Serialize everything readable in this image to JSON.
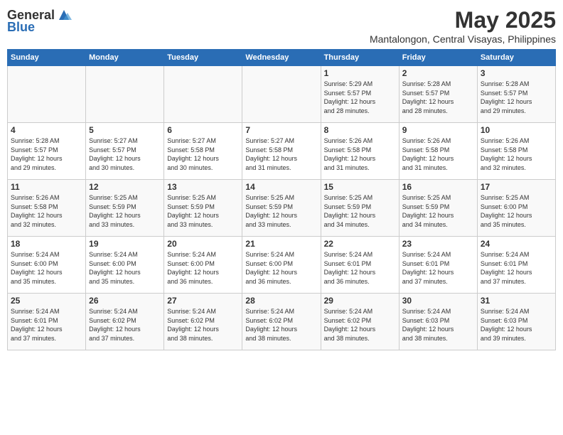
{
  "header": {
    "logo_general": "General",
    "logo_blue": "Blue",
    "month_title": "May 2025",
    "subtitle": "Mantalongon, Central Visayas, Philippines"
  },
  "weekdays": [
    "Sunday",
    "Monday",
    "Tuesday",
    "Wednesday",
    "Thursday",
    "Friday",
    "Saturday"
  ],
  "weeks": [
    [
      {
        "day": "",
        "text": ""
      },
      {
        "day": "",
        "text": ""
      },
      {
        "day": "",
        "text": ""
      },
      {
        "day": "",
        "text": ""
      },
      {
        "day": "1",
        "text": "Sunrise: 5:29 AM\nSunset: 5:57 PM\nDaylight: 12 hours\nand 28 minutes."
      },
      {
        "day": "2",
        "text": "Sunrise: 5:28 AM\nSunset: 5:57 PM\nDaylight: 12 hours\nand 28 minutes."
      },
      {
        "day": "3",
        "text": "Sunrise: 5:28 AM\nSunset: 5:57 PM\nDaylight: 12 hours\nand 29 minutes."
      }
    ],
    [
      {
        "day": "4",
        "text": "Sunrise: 5:28 AM\nSunset: 5:57 PM\nDaylight: 12 hours\nand 29 minutes."
      },
      {
        "day": "5",
        "text": "Sunrise: 5:27 AM\nSunset: 5:57 PM\nDaylight: 12 hours\nand 30 minutes."
      },
      {
        "day": "6",
        "text": "Sunrise: 5:27 AM\nSunset: 5:58 PM\nDaylight: 12 hours\nand 30 minutes."
      },
      {
        "day": "7",
        "text": "Sunrise: 5:27 AM\nSunset: 5:58 PM\nDaylight: 12 hours\nand 31 minutes."
      },
      {
        "day": "8",
        "text": "Sunrise: 5:26 AM\nSunset: 5:58 PM\nDaylight: 12 hours\nand 31 minutes."
      },
      {
        "day": "9",
        "text": "Sunrise: 5:26 AM\nSunset: 5:58 PM\nDaylight: 12 hours\nand 31 minutes."
      },
      {
        "day": "10",
        "text": "Sunrise: 5:26 AM\nSunset: 5:58 PM\nDaylight: 12 hours\nand 32 minutes."
      }
    ],
    [
      {
        "day": "11",
        "text": "Sunrise: 5:26 AM\nSunset: 5:58 PM\nDaylight: 12 hours\nand 32 minutes."
      },
      {
        "day": "12",
        "text": "Sunrise: 5:25 AM\nSunset: 5:59 PM\nDaylight: 12 hours\nand 33 minutes."
      },
      {
        "day": "13",
        "text": "Sunrise: 5:25 AM\nSunset: 5:59 PM\nDaylight: 12 hours\nand 33 minutes."
      },
      {
        "day": "14",
        "text": "Sunrise: 5:25 AM\nSunset: 5:59 PM\nDaylight: 12 hours\nand 33 minutes."
      },
      {
        "day": "15",
        "text": "Sunrise: 5:25 AM\nSunset: 5:59 PM\nDaylight: 12 hours\nand 34 minutes."
      },
      {
        "day": "16",
        "text": "Sunrise: 5:25 AM\nSunset: 5:59 PM\nDaylight: 12 hours\nand 34 minutes."
      },
      {
        "day": "17",
        "text": "Sunrise: 5:25 AM\nSunset: 6:00 PM\nDaylight: 12 hours\nand 35 minutes."
      }
    ],
    [
      {
        "day": "18",
        "text": "Sunrise: 5:24 AM\nSunset: 6:00 PM\nDaylight: 12 hours\nand 35 minutes."
      },
      {
        "day": "19",
        "text": "Sunrise: 5:24 AM\nSunset: 6:00 PM\nDaylight: 12 hours\nand 35 minutes."
      },
      {
        "day": "20",
        "text": "Sunrise: 5:24 AM\nSunset: 6:00 PM\nDaylight: 12 hours\nand 36 minutes."
      },
      {
        "day": "21",
        "text": "Sunrise: 5:24 AM\nSunset: 6:00 PM\nDaylight: 12 hours\nand 36 minutes."
      },
      {
        "day": "22",
        "text": "Sunrise: 5:24 AM\nSunset: 6:01 PM\nDaylight: 12 hours\nand 36 minutes."
      },
      {
        "day": "23",
        "text": "Sunrise: 5:24 AM\nSunset: 6:01 PM\nDaylight: 12 hours\nand 37 minutes."
      },
      {
        "day": "24",
        "text": "Sunrise: 5:24 AM\nSunset: 6:01 PM\nDaylight: 12 hours\nand 37 minutes."
      }
    ],
    [
      {
        "day": "25",
        "text": "Sunrise: 5:24 AM\nSunset: 6:01 PM\nDaylight: 12 hours\nand 37 minutes."
      },
      {
        "day": "26",
        "text": "Sunrise: 5:24 AM\nSunset: 6:02 PM\nDaylight: 12 hours\nand 37 minutes."
      },
      {
        "day": "27",
        "text": "Sunrise: 5:24 AM\nSunset: 6:02 PM\nDaylight: 12 hours\nand 38 minutes."
      },
      {
        "day": "28",
        "text": "Sunrise: 5:24 AM\nSunset: 6:02 PM\nDaylight: 12 hours\nand 38 minutes."
      },
      {
        "day": "29",
        "text": "Sunrise: 5:24 AM\nSunset: 6:02 PM\nDaylight: 12 hours\nand 38 minutes."
      },
      {
        "day": "30",
        "text": "Sunrise: 5:24 AM\nSunset: 6:03 PM\nDaylight: 12 hours\nand 38 minutes."
      },
      {
        "day": "31",
        "text": "Sunrise: 5:24 AM\nSunset: 6:03 PM\nDaylight: 12 hours\nand 39 minutes."
      }
    ]
  ]
}
